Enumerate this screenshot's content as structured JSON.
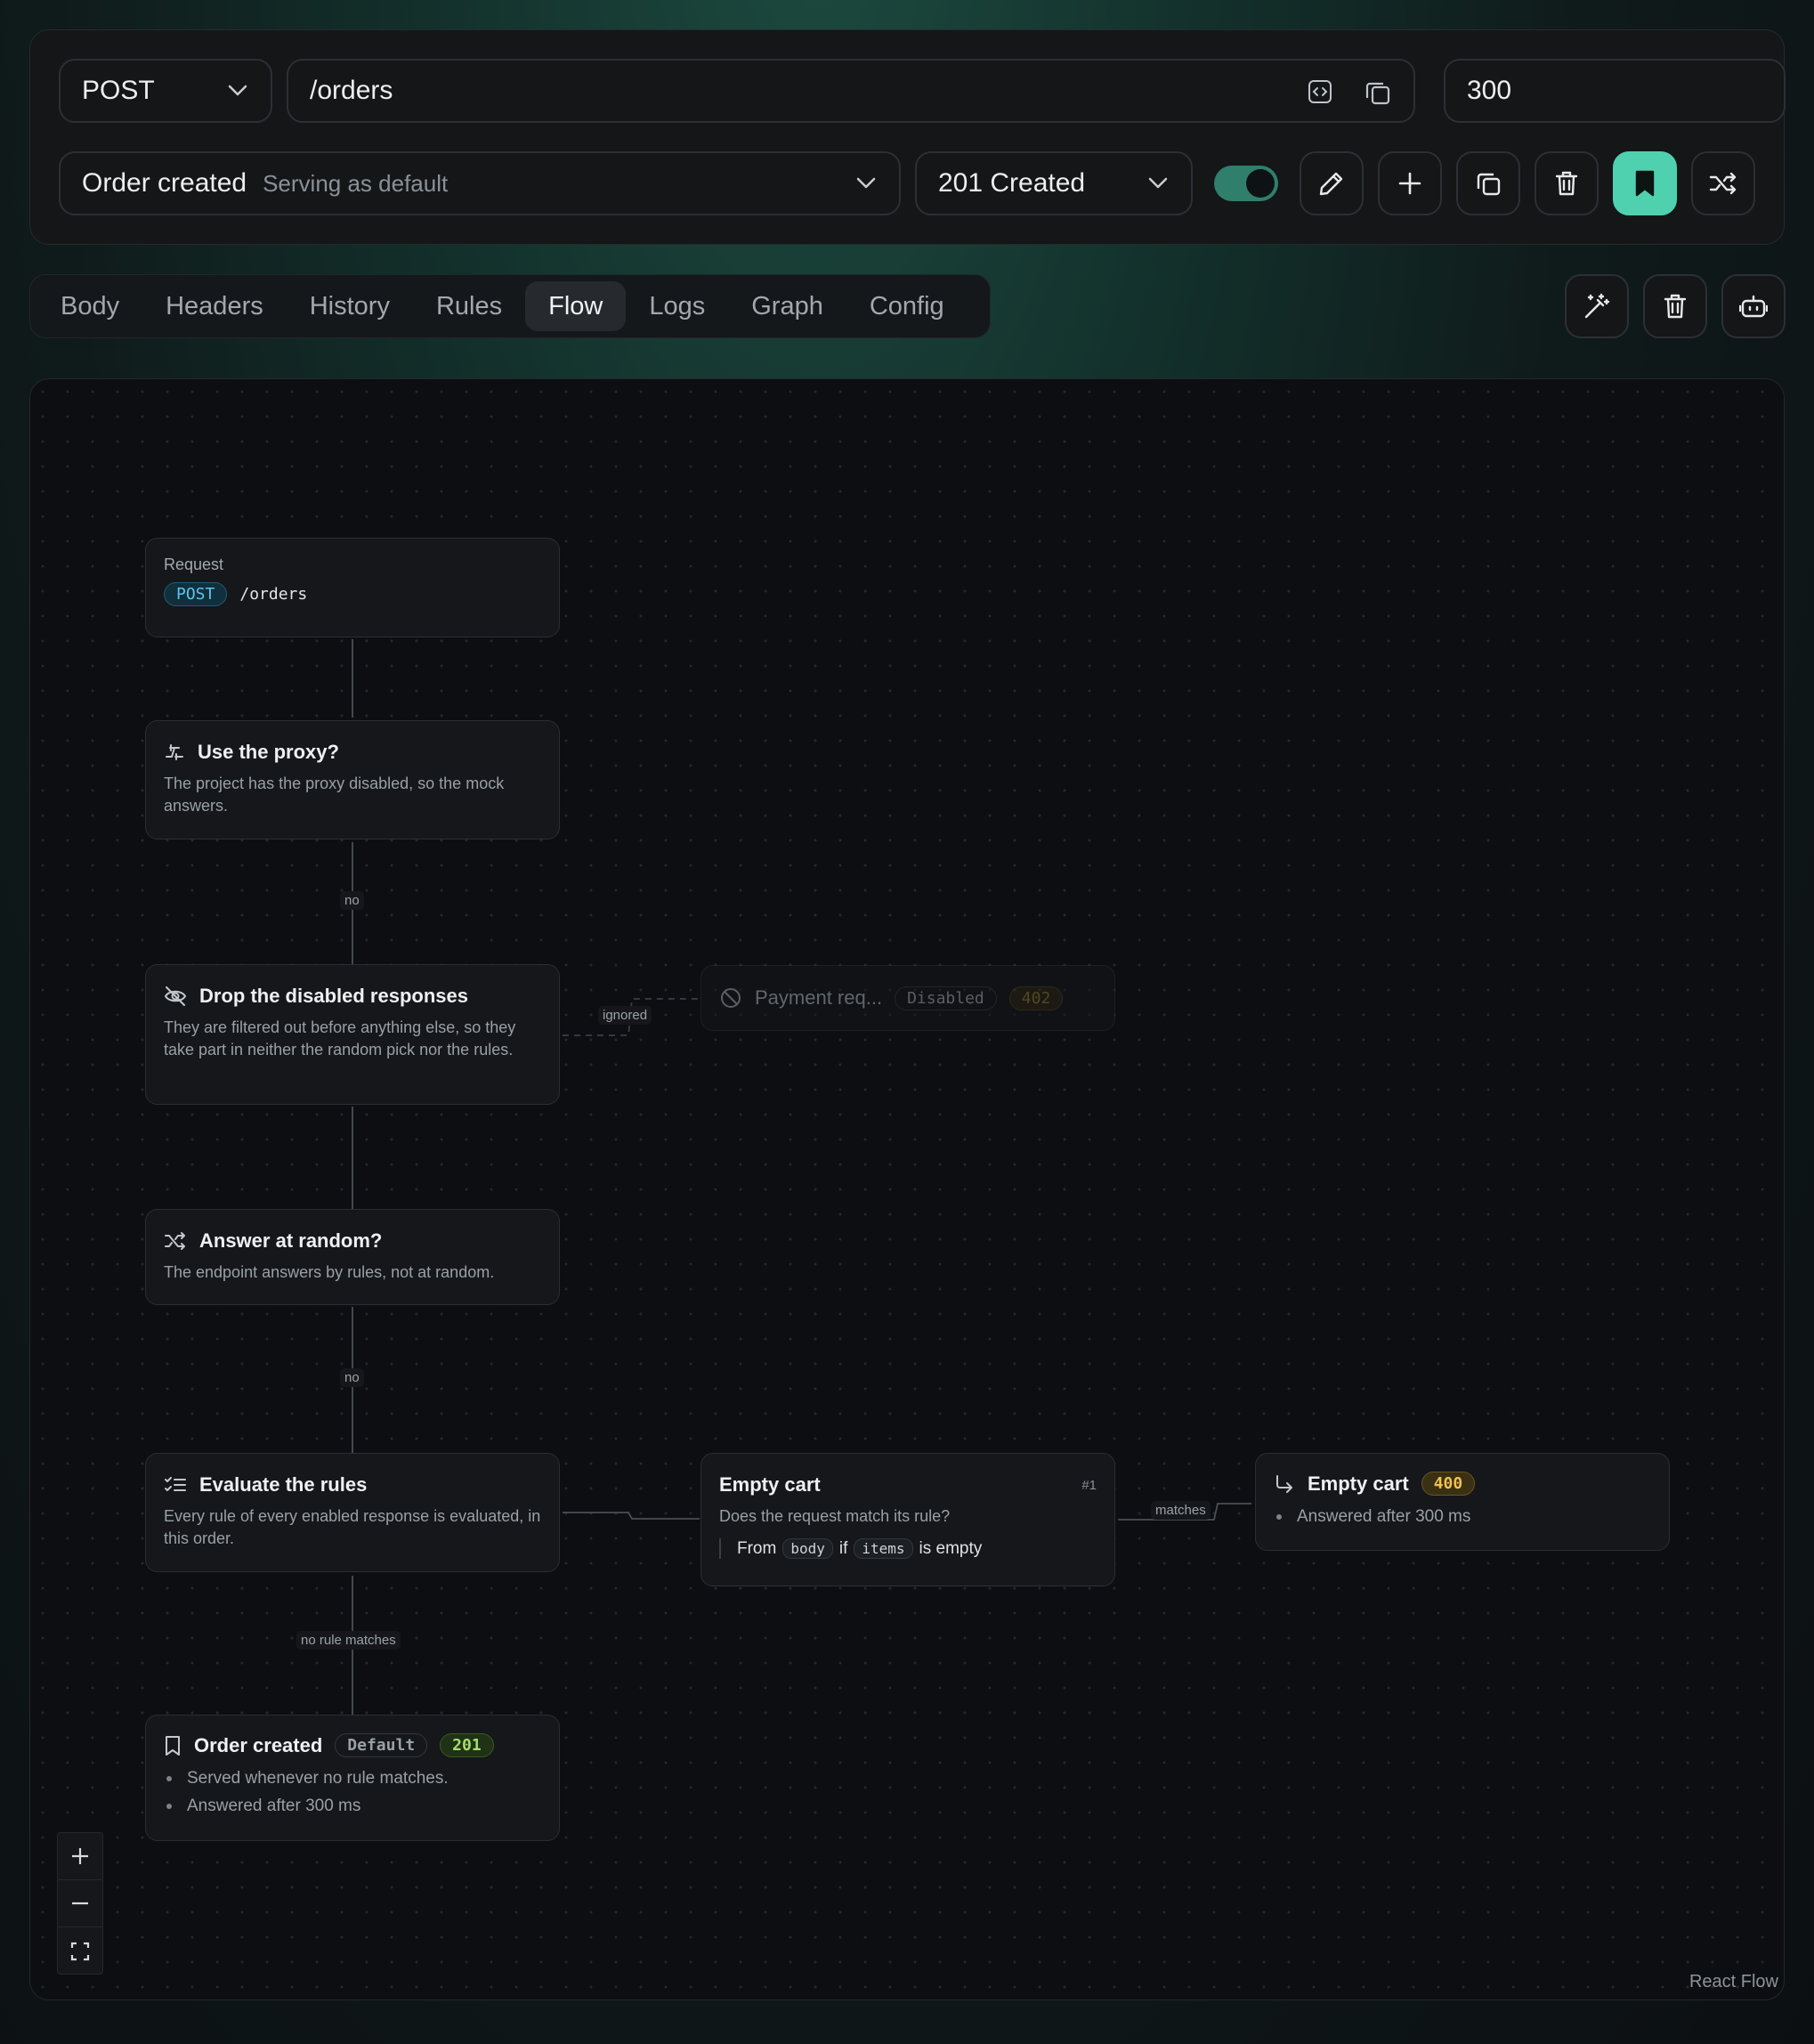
{
  "endpoint": {
    "method": "POST",
    "path": "/orders",
    "delay": "300"
  },
  "response_bar": {
    "name": "Order created",
    "subtitle": "Serving as default",
    "status": "201 Created",
    "enabled": true
  },
  "toolbar_icons": [
    "pencil-icon",
    "plus-icon",
    "copy-icon",
    "trash-icon",
    "bookmark-icon",
    "shuffle-icon"
  ],
  "tabs": [
    {
      "label": "Body"
    },
    {
      "label": "Headers"
    },
    {
      "label": "History"
    },
    {
      "label": "Rules"
    },
    {
      "label": "Flow",
      "active": true
    },
    {
      "label": "Logs"
    },
    {
      "label": "Graph"
    },
    {
      "label": "Config"
    }
  ],
  "tab_actions": [
    "magic-wand-icon",
    "trash-icon",
    "robot-icon"
  ],
  "flow": {
    "request": {
      "title": "Request",
      "method": "POST",
      "path": "/orders"
    },
    "proxy": {
      "title": "Use the proxy?",
      "desc": "The project has the proxy disabled, so the mock answers."
    },
    "drop": {
      "title": "Drop the disabled responses",
      "desc": "They are filtered out before anything else, so they take part in neither the random pick nor the rules."
    },
    "disabled_response": {
      "name": "Payment req...",
      "state": "Disabled",
      "code": "402"
    },
    "random": {
      "title": "Answer at random?",
      "desc": "The endpoint answers by rules, not at random."
    },
    "rules": {
      "title": "Evaluate the rules",
      "desc": "Every rule of every enabled response is evaluated, in this order."
    },
    "rule": {
      "title": "Empty cart",
      "index": "#1",
      "question": "Does the request match its rule?",
      "from_word": "From",
      "source": "body",
      "if_word": "if",
      "field": "items",
      "condition": "is empty"
    },
    "match_result": {
      "title": "Empty cart",
      "code": "400",
      "detail": "Answered after 300 ms"
    },
    "default": {
      "title": "Order created",
      "tag": "Default",
      "code": "201",
      "details": [
        "Served whenever no rule matches.",
        "Answered after 300 ms"
      ]
    },
    "edges": {
      "no1": "no",
      "ignored": "ignored",
      "no2": "no",
      "matches": "matches",
      "no_rule": "no rule matches"
    }
  },
  "attribution": "React Flow",
  "colors": {
    "accent": "#4fd1b0",
    "toggle_on": "#2f7f6c"
  }
}
